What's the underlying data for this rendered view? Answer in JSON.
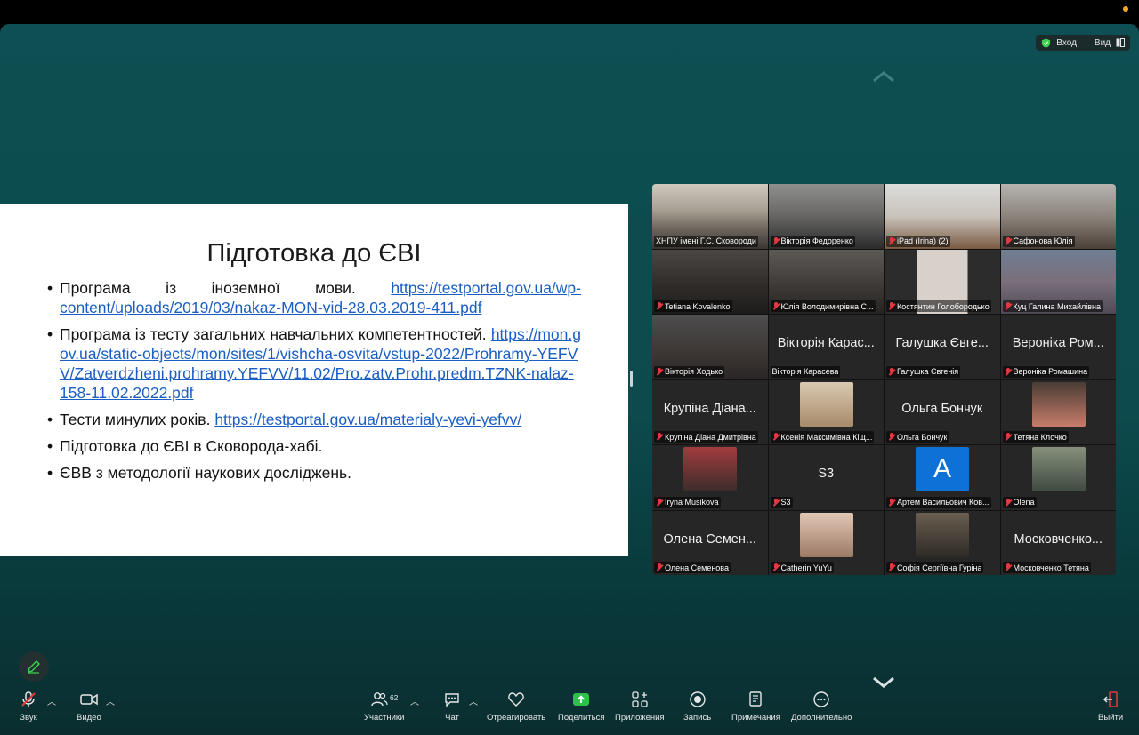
{
  "topright": {
    "enter_label": "Вход",
    "view_label": "Вид"
  },
  "slide": {
    "title": "Підготовка до  ЄВІ",
    "b1_text": "Програма із іноземної мови. ",
    "b1_link": "https://testportal.gov.ua/wp-content/uploads/2019/03/nakaz-MON-vid-28.03.2019-411.pdf",
    "b2_text": "Програма із тесту загальних навчальних компетентностей. ",
    "b2_link": "https://mon.gov.ua/static-objects/mon/sites/1/vishcha-osvita/vstup-2022/Prohramy-YEFVV/Zatverdzheni.prohramy.YEFVV/11.02/Pro.zatv.Prohr.predm.TZNK-nalaz-158-11.02.2022.pdf",
    "b3_text": "Тести минулих років. ",
    "b3_link": "https://testportal.gov.ua/materialy-yevi-yefvv/",
    "b4_text": "Підготовка до ЄВІ в Сковорода-хабі.",
    "b5_text": "ЄВВ з методології наукових досліджень."
  },
  "participants": [
    {
      "name": "ХНПУ імені Г.С. Сковороди",
      "big": "",
      "mic": false,
      "kind": "room"
    },
    {
      "name": "Вікторія Федоренко",
      "big": "",
      "mic": true,
      "kind": "video"
    },
    {
      "name": "iPad (Irina) (2)",
      "big": "",
      "mic": true,
      "kind": "video"
    },
    {
      "name": "Сафонова Юлія",
      "big": "",
      "mic": true,
      "kind": "video"
    },
    {
      "name": "Tetiana Kovalenko",
      "big": "",
      "mic": true,
      "kind": "video"
    },
    {
      "name": "Юлія Володимирівна С...",
      "big": "",
      "mic": true,
      "kind": "video"
    },
    {
      "name": "Костянтин Голобородько",
      "big": "",
      "mic": true,
      "kind": "video"
    },
    {
      "name": "Куц Галина Михайлівна",
      "big": "",
      "mic": true,
      "kind": "video"
    },
    {
      "name": "Вікторія Ходько",
      "big": "",
      "mic": true,
      "kind": "video"
    },
    {
      "name": "Вікторія Карасева",
      "big": "Вікторія Карас...",
      "mic": false,
      "kind": "name"
    },
    {
      "name": "Галушка Євгенія",
      "big": "Галушка Євге...",
      "mic": true,
      "kind": "name"
    },
    {
      "name": "Вероніка Ромашина",
      "big": "Вероніка Ром...",
      "mic": true,
      "kind": "name"
    },
    {
      "name": "Крупіна Діана Дмитрівна",
      "big": "Крупіна Діана...",
      "mic": true,
      "kind": "name"
    },
    {
      "name": "Ксенія Максимівна Кіщ...",
      "big": "",
      "mic": true,
      "kind": "avatar"
    },
    {
      "name": "Ольга Бончук",
      "big": "Ольга Бончук",
      "mic": true,
      "kind": "name"
    },
    {
      "name": "Тетяна Клочко",
      "big": "",
      "mic": true,
      "kind": "avatar"
    },
    {
      "name": "Iryna Musikova",
      "big": "",
      "mic": true,
      "kind": "avatar"
    },
    {
      "name": "S3",
      "big": "S3",
      "mic": true,
      "kind": "name"
    },
    {
      "name": "Артем Васильович Ков...",
      "big": "A",
      "mic": true,
      "kind": "letter"
    },
    {
      "name": "Olena",
      "big": "",
      "mic": true,
      "kind": "avatar"
    },
    {
      "name": "Олена Семенова",
      "big": "Олена Семен...",
      "mic": true,
      "kind": "name"
    },
    {
      "name": "Catherin YuYu",
      "big": "",
      "mic": true,
      "kind": "avatar"
    },
    {
      "name": "Софія Сергіївна Гуріна",
      "big": "",
      "mic": true,
      "kind": "avatar"
    },
    {
      "name": "Московченко Тетяна",
      "big": "Московченко...",
      "mic": true,
      "kind": "name"
    }
  ],
  "toolbar": {
    "audio": "Звук",
    "video": "Видео",
    "participants": "Участники",
    "participants_count": "62",
    "chat": "Чат",
    "react": "Отреагировать",
    "share": "Поделиться",
    "apps": "Приложения",
    "record": "Запись",
    "notes": "Примечания",
    "more": "Дополнительно",
    "leave": "Выйти"
  },
  "colors": {
    "accent_green": "#3ed34a",
    "share_green": "#2fbf4a",
    "muted_red": "#e0393e",
    "link_blue": "#1a5ec4"
  }
}
